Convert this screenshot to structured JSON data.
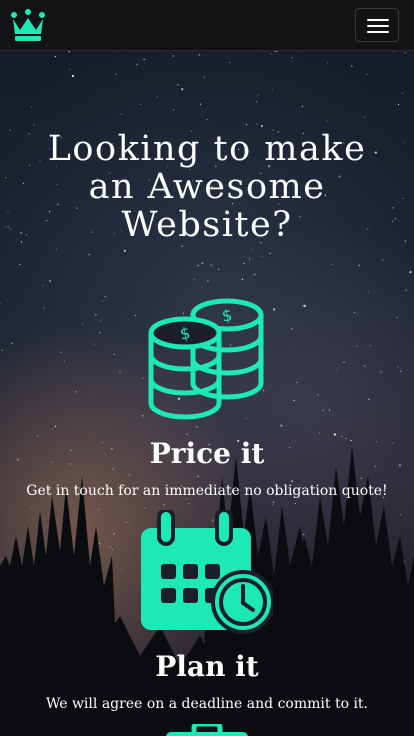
{
  "brand": {
    "logo_icon": "crown-icon",
    "accent_color": "#1de9b6"
  },
  "navbar": {
    "menu_icon": "hamburger-menu-icon"
  },
  "hero": {
    "headline_line1": "Looking to make",
    "headline_line2": "an Awesome",
    "headline_line3": "Website?"
  },
  "features": [
    {
      "icon": "coins-icon",
      "title": "Price it",
      "text": "Get in touch for an immediate no obligation quote!"
    },
    {
      "icon": "calendar-clock-icon",
      "title": "Plan it",
      "text": "We will agree on a deadline and commit to it."
    },
    {
      "icon": "briefcase-icon"
    }
  ]
}
